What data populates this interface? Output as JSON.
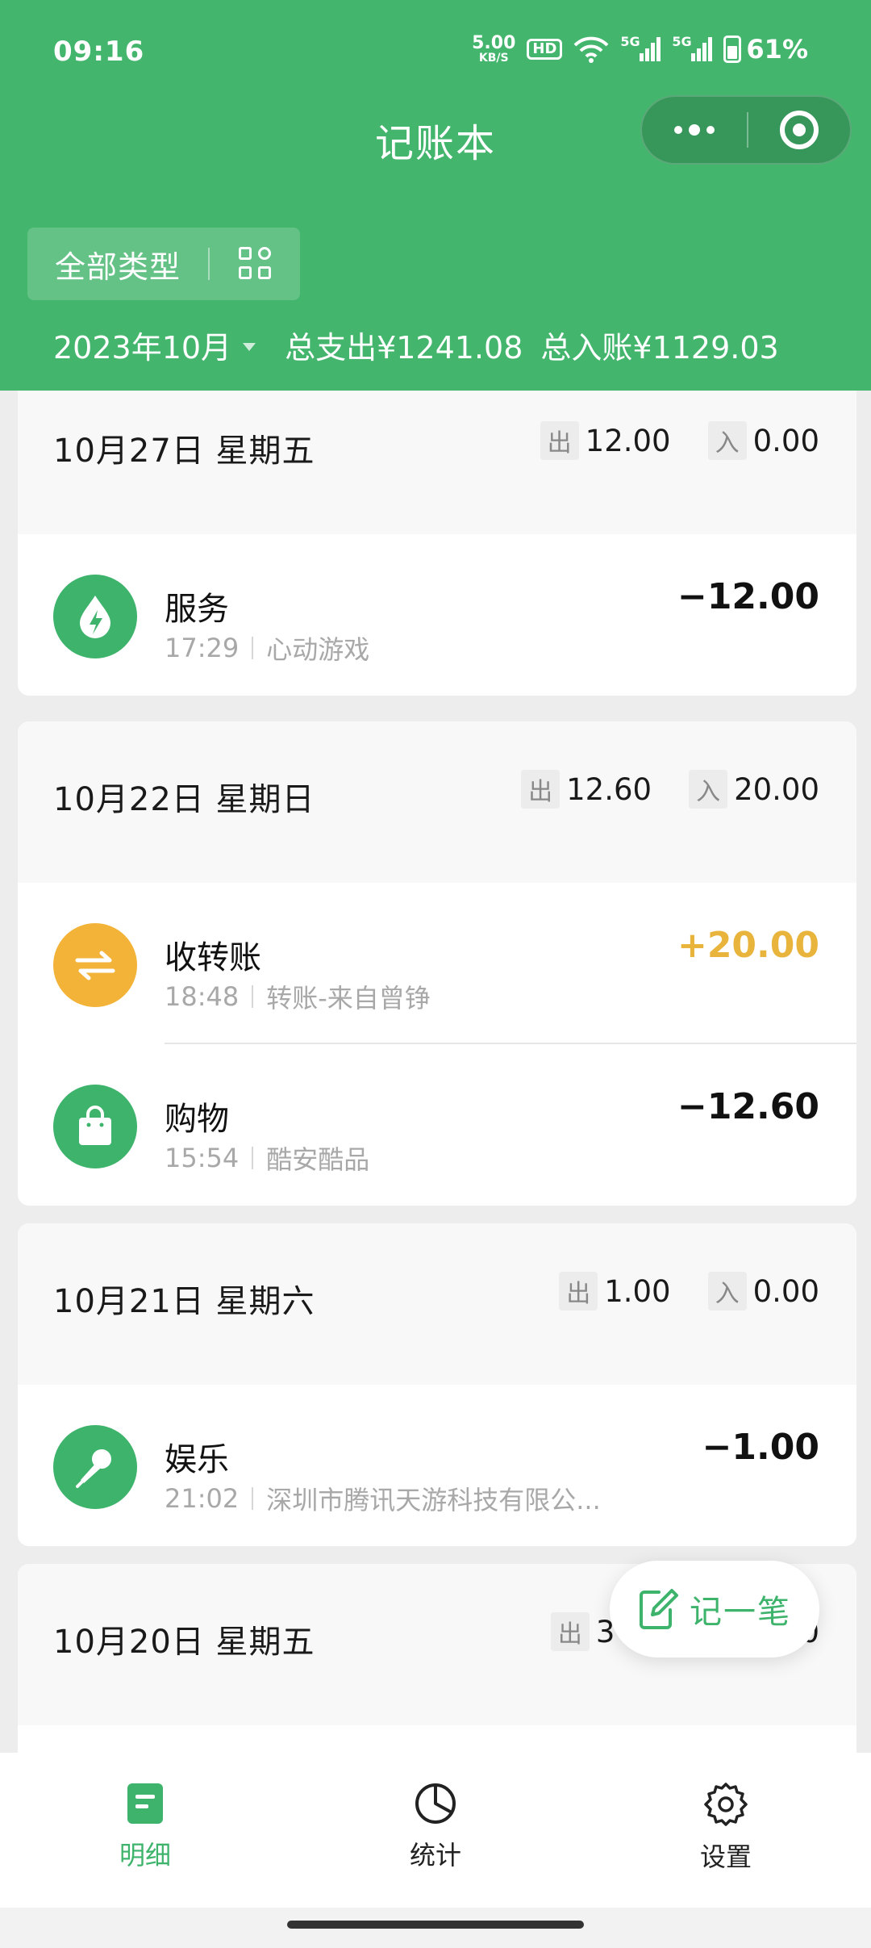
{
  "status_bar": {
    "time": "09:16",
    "net_speed_value": "5.00",
    "net_speed_unit": "KB/S",
    "hd_badge": "HD",
    "signal_1": "5G",
    "signal_2": "5G",
    "battery": "61%"
  },
  "header": {
    "title": "记账本",
    "type_filter_label": "全部类型",
    "month": "2023年10月",
    "total_expense": "总支出¥1241.08",
    "total_income": "总入账¥1129.03",
    "bg_color": "#43b56d"
  },
  "days": [
    {
      "date": "10月27日 星期五",
      "out_label": "出",
      "out_amount": "12.00",
      "in_label": "入",
      "in_amount": "0.00",
      "entries": [
        {
          "icon": "water-drop-bolt-icon",
          "title": "服务",
          "time": "17:29",
          "merchant": "心动游戏",
          "amount": "−12.00"
        }
      ]
    },
    {
      "date": "10月22日 星期日",
      "out_label": "出",
      "out_amount": "12.60",
      "in_label": "入",
      "in_amount": "20.00",
      "entries": [
        {
          "icon": "transfer-arrows-icon",
          "title": "收转账",
          "time": "18:48",
          "merchant": "转账-来自曾铮",
          "amount": "+20.00"
        },
        {
          "icon": "shopping-bag-icon",
          "title": "购物",
          "time": "15:54",
          "merchant": "酷安酷品",
          "amount": "−12.60"
        }
      ]
    },
    {
      "date": "10月21日 星期六",
      "out_label": "出",
      "out_amount": "1.00",
      "in_label": "入",
      "in_amount": "0.00",
      "entries": [
        {
          "icon": "microphone-icon",
          "title": "娱乐",
          "time": "21:02",
          "merchant": "深圳市腾讯天游科技有限公...",
          "amount": "−1.00"
        }
      ]
    },
    {
      "date": "10月20日 星期五",
      "out_label": "出",
      "out_amount_partial": "3",
      "in_amount_partial": "0"
    }
  ],
  "fab": {
    "label": "记一笔",
    "color": "#3db36b"
  },
  "bottom_nav": [
    {
      "label": "明细",
      "icon": "document-icon",
      "active": true
    },
    {
      "label": "统计",
      "icon": "pie-chart-icon",
      "active": false
    },
    {
      "label": "设置",
      "icon": "gear-icon",
      "active": false
    }
  ],
  "colors": {
    "accent": "#3db36b",
    "income": "#e8b43b",
    "transfer_icon": "#f2b338"
  }
}
